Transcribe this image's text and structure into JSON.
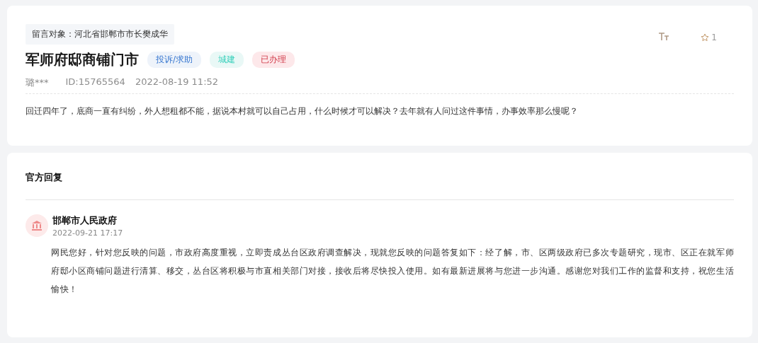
{
  "message": {
    "target": "留言对象：河北省邯郸市市长樊成华",
    "title": "军师府邸商铺门市",
    "tags": [
      {
        "label": "投诉/求助",
        "color": "#eef3fa"
      },
      {
        "label": "城建",
        "color": "#e9f8f6"
      },
      {
        "label": "已办理",
        "color": "#fde8ea"
      }
    ],
    "author": "璐***",
    "id": "ID:15765564",
    "time": "2022-08-19 11:52",
    "favorites": "1",
    "body": "回迁四年了，底商一直有纠纷，外人想租都不能，据说本村就可以自己占用，什么时候才可以解决？去年就有人问过这件事情，办事效率那么慢呢？"
  },
  "reply": {
    "heading": "官方回复",
    "department": "邯郸市人民政府",
    "time": "2022-09-21 17:17",
    "body": "网民您好，针对您反映的问题，市政府高度重视，立即责成丛台区政府调查解决，现就您反映的问题答复如下：经了解，市、区两级政府已多次专题研究，现市、区正在就军师府邸小区商铺问题进行清算、移交，丛台区将积极与市直相关部门对接，接收后将尽快投入使用。如有最新进展将与您进一步沟通。感谢您对我们工作的监督和支持，祝您生活愉快！"
  }
}
